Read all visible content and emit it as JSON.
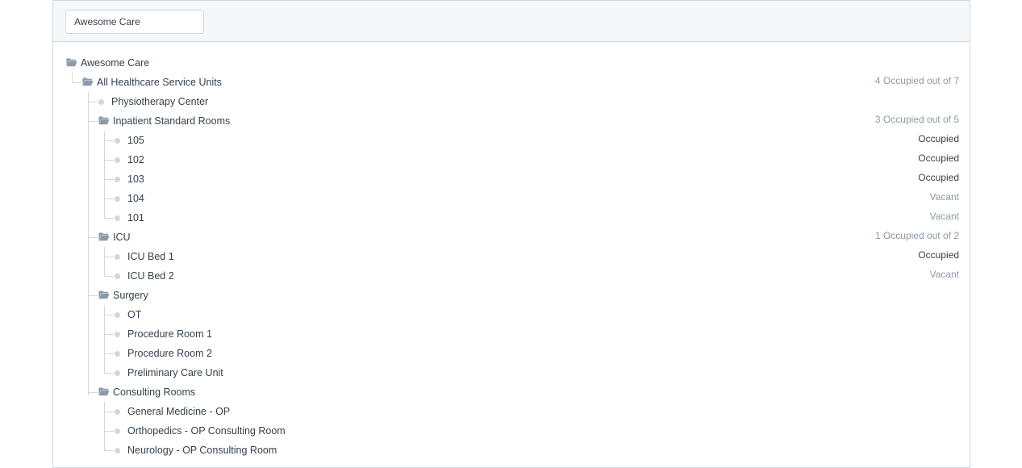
{
  "filter": {
    "company_value": "Awesome Care"
  },
  "tree": {
    "root": {
      "label": "Awesome Care"
    },
    "all_units": {
      "label": "All Healthcare Service Units",
      "status": "4 Occupied out of 7"
    },
    "physio": {
      "label": "Physiotherapy Center"
    },
    "inpatient": {
      "label": "Inpatient Standard Rooms",
      "status": "3 Occupied out of 5",
      "children": [
        {
          "label": "105",
          "status": "Occupied"
        },
        {
          "label": "102",
          "status": "Occupied"
        },
        {
          "label": "103",
          "status": "Occupied"
        },
        {
          "label": "104",
          "status": "Vacant"
        },
        {
          "label": "101",
          "status": "Vacant"
        }
      ]
    },
    "icu": {
      "label": "ICU",
      "status": "1 Occupied out of 2",
      "children": [
        {
          "label": "ICU Bed 1",
          "status": "Occupied"
        },
        {
          "label": "ICU Bed 2",
          "status": "Vacant"
        }
      ]
    },
    "surgery": {
      "label": "Surgery",
      "children": [
        {
          "label": "OT"
        },
        {
          "label": "Procedure Room 1"
        },
        {
          "label": "Procedure Room 2"
        },
        {
          "label": "Preliminary Care Unit"
        }
      ]
    },
    "consulting": {
      "label": "Consulting Rooms",
      "children": [
        {
          "label": "General Medicine - OP"
        },
        {
          "label": "Orthopedics - OP Consulting Room"
        },
        {
          "label": "Neurology - OP Consulting Room"
        }
      ]
    }
  },
  "colors": {
    "text": "#36414c",
    "muted": "#8d99a6",
    "border": "#d1d8dd",
    "toolbar_bg": "#f5f7fa"
  }
}
